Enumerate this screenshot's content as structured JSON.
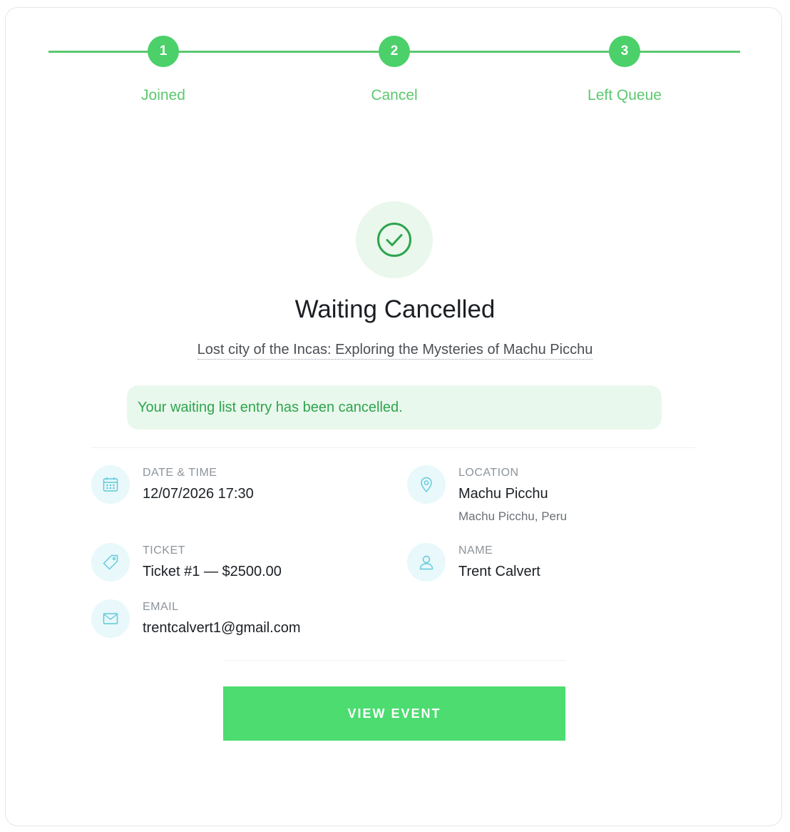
{
  "stepper": {
    "steps": [
      {
        "number": "1",
        "label": "Joined"
      },
      {
        "number": "2",
        "label": "Cancel"
      },
      {
        "number": "3",
        "label": "Left Queue"
      }
    ]
  },
  "header": {
    "title": "Waiting Cancelled",
    "event_name": "Lost city of the Incas: Exploring the Mysteries of Machu Picchu"
  },
  "alert": {
    "message": "Your waiting list entry has been cancelled."
  },
  "details": {
    "date_time": {
      "label": "DATE & TIME",
      "value": "12/07/2026 17:30",
      "icon": "calendar-icon"
    },
    "location": {
      "label": "LOCATION",
      "value": "Machu Picchu",
      "sub": "Machu Picchu, Peru",
      "icon": "location-pin-icon"
    },
    "ticket": {
      "label": "TICKET",
      "value": "Ticket #1 — $2500.00",
      "icon": "tag-icon"
    },
    "name": {
      "label": "NAME",
      "value": "Trent Calvert",
      "icon": "user-icon"
    },
    "email": {
      "label": "EMAIL",
      "value": "trentcalvert1@gmail.com",
      "icon": "mail-icon"
    }
  },
  "actions": {
    "view_event_label": "VIEW EVENT"
  },
  "colors": {
    "accent_green": "#4cd06a",
    "alert_bg": "#e9f8ec",
    "alert_text": "#2ea44f",
    "icon_bg": "#e8f8fb",
    "icon_stroke": "#5fc9d8"
  }
}
